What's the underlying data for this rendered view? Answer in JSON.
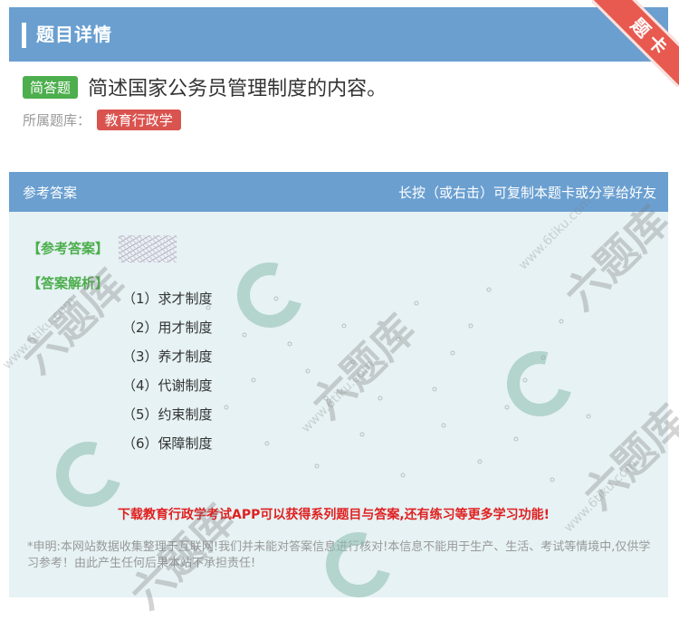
{
  "header": {
    "title": "题目详情",
    "ribbon": "题卡"
  },
  "question": {
    "type": "简答题",
    "text": "简述国家公务员管理制度的内容。",
    "bank_label": "所属题库：",
    "bank": "教育行政学"
  },
  "answer": {
    "head_left": "参考答案",
    "head_right": "长按（或右击）可复制本题卡或分享给好友",
    "ref_label": "【参考答案】",
    "analysis_label": "【答案解析】",
    "points": [
      "（1）求才制度",
      "（2）用才制度",
      "（3）养才制度",
      "（4）代谢制度",
      "（5）约束制度",
      "（6）保障制度"
    ],
    "promo": "下载教育行政学考试APP可以获得系列题目与答案,还有练习等更多学习功能!",
    "disclaimer": "*申明:本网站数据收集整理于互联网!我们并未能对答案信息进行核对!本信息不能用于生产、生活、考试等情境中,仅供学习参考！由此产生任何后果本站不承担责任!"
  },
  "watermark": {
    "text": "六题库",
    "url": "www.6tiku.com"
  },
  "colors": {
    "header": "#6a9fd0",
    "green": "#4cae4c",
    "red": "#d9534f",
    "panel": "#e6f2f4"
  }
}
